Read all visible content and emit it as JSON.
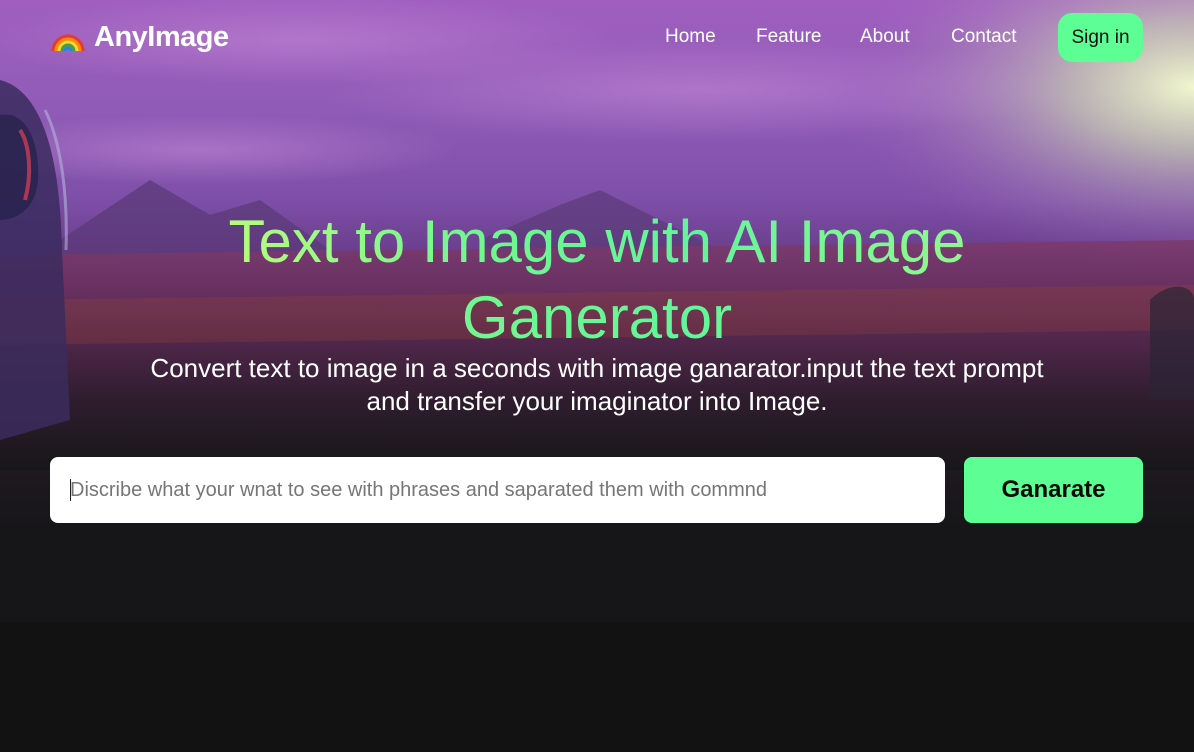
{
  "brand": {
    "name": "AnyImage",
    "logo_icon": "rainbow-icon"
  },
  "nav": {
    "links": [
      "Home",
      "Feature",
      "About",
      "Contact"
    ],
    "signin_label": "Sign in"
  },
  "hero": {
    "headline": "Text to Image with AI Image Ganerator",
    "subtitle": "Convert text to image in a seconds with image ganarator.input the text prompt and transfer your imaginator into Image.",
    "prompt": {
      "value": "",
      "placeholder": "Discribe what your wnat to see with phrases and saparated them with commnd"
    },
    "generate_label": "Ganarate"
  },
  "colors": {
    "accent": "#5dff94",
    "headline_gradient_start": "#cffd78",
    "headline_gradient_mid": "#62f59a",
    "background_dark": "#121212"
  }
}
